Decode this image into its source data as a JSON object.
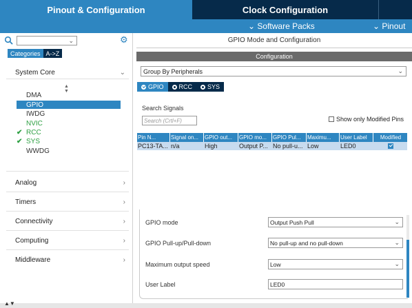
{
  "top_tabs": {
    "pinout": "Pinout & Configuration",
    "clock": "Clock Configuration"
  },
  "sub_bar": {
    "software_packs": "⌄ Software Packs",
    "pinout": "⌄ Pinout"
  },
  "left": {
    "categories_tab": "Categories",
    "az_tab": "A->Z",
    "system_core": "System Core",
    "core_items": [
      {
        "label": "DMA",
        "state": "normal"
      },
      {
        "label": "GPIO",
        "state": "selected"
      },
      {
        "label": "IWDG",
        "state": "normal"
      },
      {
        "label": "NVIC",
        "state": "green"
      },
      {
        "label": "RCC",
        "state": "checked"
      },
      {
        "label": "SYS",
        "state": "checked"
      },
      {
        "label": "WWDG",
        "state": "normal"
      }
    ],
    "groups": [
      "Analog",
      "Timers",
      "Connectivity",
      "Computing",
      "Middleware"
    ]
  },
  "right": {
    "mode_title": "GPIO Mode and Configuration",
    "config_header": "Configuration",
    "group_select": "Group By Peripherals",
    "periph_tabs": [
      "GPIO",
      "RCC",
      "SYS"
    ],
    "search_signals_label": "Search Signals",
    "search_placeholder": "Search (Crtl+F)",
    "only_modified": "Show only Modified Pins",
    "table_headers": [
      "Pin N...",
      "Signal on...",
      "GPIO out...",
      "GPIO mo...",
      "GPIO Pul...",
      "Maximu...",
      "User Label",
      "Modified"
    ],
    "table_row": [
      "PC13-TA...",
      "n/a",
      "High",
      "Output P...",
      "No pull-u...",
      "Low",
      "LED0"
    ],
    "config": {
      "gpio_mode_label": "GPIO mode",
      "gpio_mode_value": "Output Push Pull",
      "pull_label": "GPIO Pull-up/Pull-down",
      "pull_value": "No pull-up and no pull-down",
      "speed_label": "Maximum output speed",
      "speed_value": "Low",
      "user_label_label": "User Label",
      "user_label_value": "LED0"
    }
  },
  "colors": {
    "accent": "#2e86c1",
    "dark": "#062a4a",
    "green": "#2ea043"
  }
}
